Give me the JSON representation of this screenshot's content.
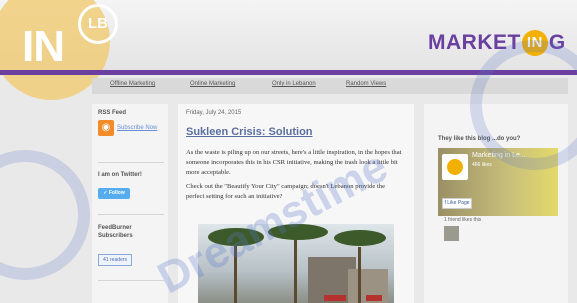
{
  "header": {
    "logo": {
      "main": "IN",
      "badge": "LB"
    },
    "brand": {
      "part1": "MARKET",
      "circle": "IN",
      "part2": "G"
    }
  },
  "nav": {
    "items": [
      {
        "label": "Offline Marketing"
      },
      {
        "label": "Online Marketing"
      },
      {
        "label": "Only in Lebanon"
      },
      {
        "label": "Random Views"
      }
    ]
  },
  "sidebar": {
    "rss_title": "RSS Feed",
    "rss_link": "Subscribe Now",
    "twitter_title": "I am on Twitter!",
    "follow_label": "Follow",
    "feedburner_title": "FeedBurner Subscribers",
    "counter": "41 readers"
  },
  "post": {
    "date": "Friday, July 24, 2015",
    "title": "Sukleen Crisis: Solution",
    "paragraph1": "As the waste is piling up on our streets, here's a little inspiration, in the hopes that someone incorporates this in his CSR initiative, making the trash look a little bit more acceptable.",
    "paragraph2": "Check out the \"Beautify Your City\" campaign; doesn't Lebanon provide the perfect setting for such an initiative?"
  },
  "right": {
    "widget_title": "They like this blog ...do you?",
    "fb_page_name": "Marketing in Le...",
    "fb_likes": "466 likes",
    "fb_like_button": "Like Page",
    "fb_friend_text": "1 friend likes this"
  },
  "watermark": {
    "text": "Dreamstime"
  },
  "colors": {
    "brand_purple": "#6b3fa0",
    "logo_yellow": "#f2b000",
    "link_blue": "#5b6f9e",
    "twitter_blue": "#55acee"
  }
}
